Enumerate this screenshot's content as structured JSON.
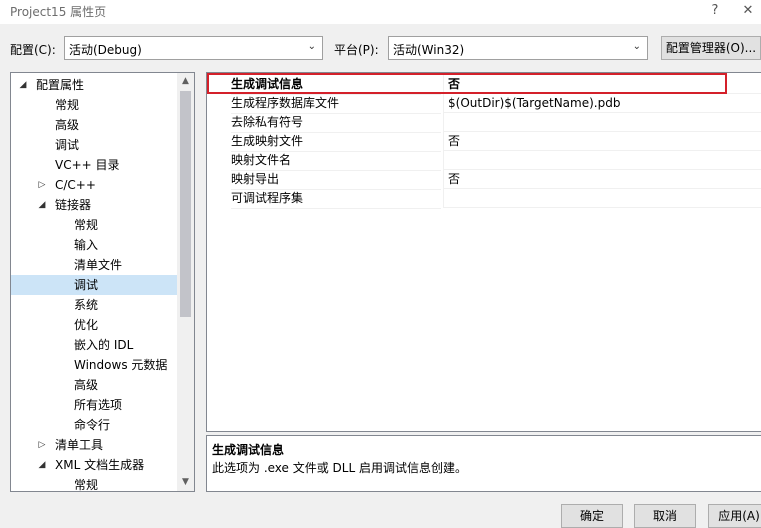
{
  "window": {
    "title": "Project15 属性页",
    "help_glyph": "?",
    "close_glyph": "✕"
  },
  "config_bar": {
    "config_label": "配置(C):",
    "config_value": "活动(Debug)",
    "platform_label": "平台(P):",
    "platform_value": "活动(Win32)",
    "manager_button": "配置管理器(O)..."
  },
  "tree": {
    "items": [
      {
        "label": "配置属性",
        "expander": "◢"
      },
      {
        "label": "常规",
        "expander": ""
      },
      {
        "label": "高级",
        "expander": ""
      },
      {
        "label": "调试",
        "expander": ""
      },
      {
        "label": "VC++ 目录",
        "expander": ""
      },
      {
        "label": "C/C++",
        "expander": "▷"
      },
      {
        "label": "链接器",
        "expander": "◢"
      },
      {
        "label": "常规",
        "expander": ""
      },
      {
        "label": "输入",
        "expander": ""
      },
      {
        "label": "清单文件",
        "expander": ""
      },
      {
        "label": "调试",
        "expander": "",
        "selected": true
      },
      {
        "label": "系统",
        "expander": ""
      },
      {
        "label": "优化",
        "expander": ""
      },
      {
        "label": "嵌入的 IDL",
        "expander": ""
      },
      {
        "label": "Windows 元数据",
        "expander": ""
      },
      {
        "label": "高级",
        "expander": ""
      },
      {
        "label": "所有选项",
        "expander": ""
      },
      {
        "label": "命令行",
        "expander": ""
      },
      {
        "label": "清单工具",
        "expander": "▷"
      },
      {
        "label": "XML 文档生成器",
        "expander": "◢"
      },
      {
        "label": "常规",
        "expander": ""
      }
    ],
    "scroll_up_glyph": "▲",
    "scroll_down_glyph": "▼"
  },
  "properties": {
    "rows": [
      {
        "name": "生成调试信息",
        "value": "否"
      },
      {
        "name": "生成程序数据库文件",
        "value": "$(OutDir)$(TargetName).pdb"
      },
      {
        "name": "去除私有符号",
        "value": ""
      },
      {
        "name": "生成映射文件",
        "value": "否"
      },
      {
        "name": "映射文件名",
        "value": ""
      },
      {
        "name": "映射导出",
        "value": "否"
      },
      {
        "name": "可调试程序集",
        "value": ""
      }
    ]
  },
  "description": {
    "title": "生成调试信息",
    "text": "此选项为 .exe 文件或 DLL 启用调试信息创建。"
  },
  "footer": {
    "ok": "确定",
    "cancel": "取消",
    "apply": "应用(A)"
  },
  "colors": {
    "highlight_border": "#d4202a",
    "tree_selected": "#cce4f7",
    "dialog_bg": "#f0f0f0"
  }
}
